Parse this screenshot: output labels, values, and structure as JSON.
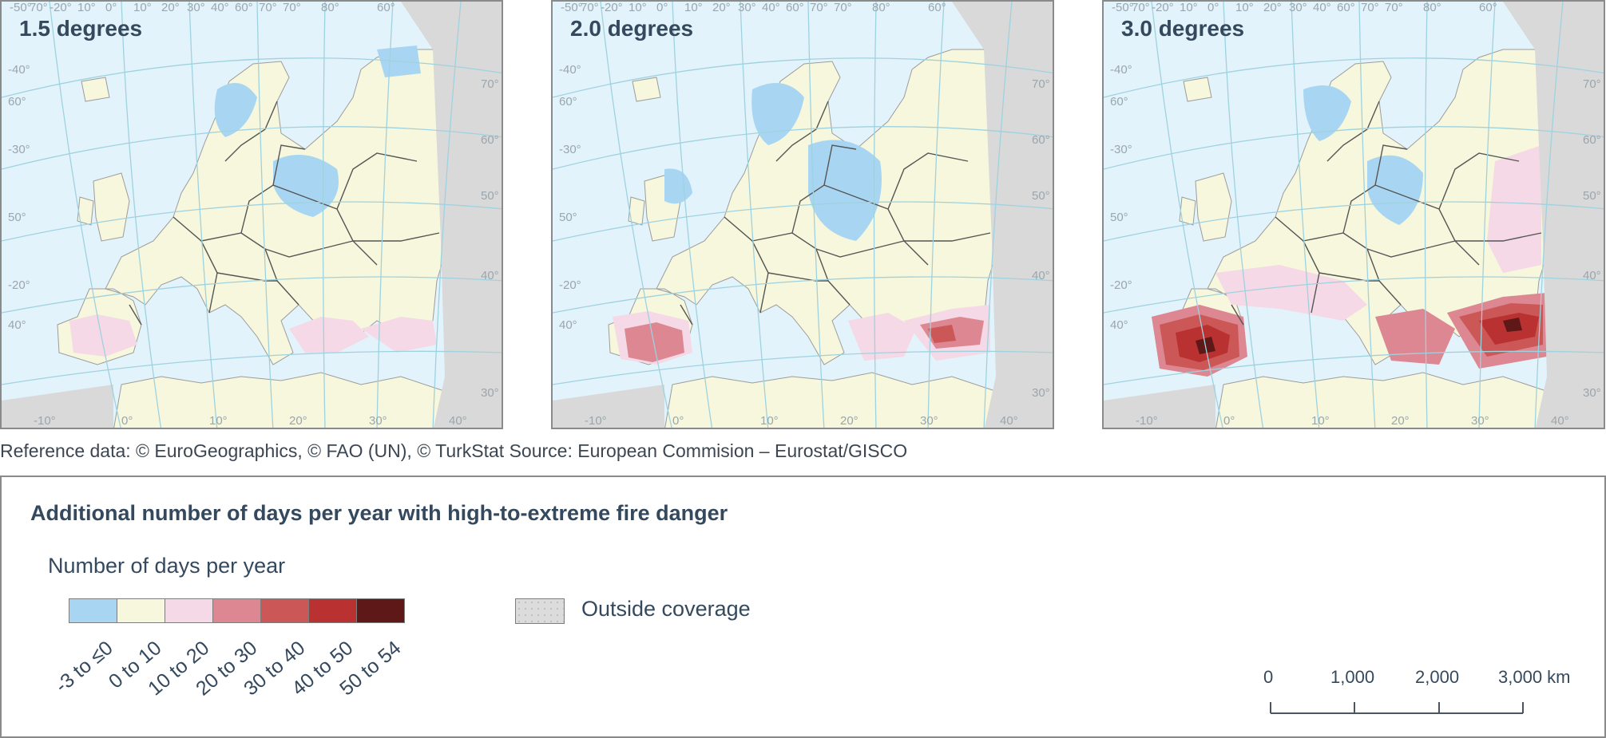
{
  "panels": [
    {
      "title": "1.5 degrees",
      "level": 1
    },
    {
      "title": "2.0 degrees",
      "level": 2
    },
    {
      "title": "3.0 degrees",
      "level": 3
    }
  ],
  "graticule_labels": {
    "top": [
      "-50°",
      "70°",
      "-20°",
      "10°",
      "0°",
      "10°",
      "20°",
      "30°",
      "40°",
      "60°",
      "70°",
      "70°",
      "80°",
      "60°"
    ],
    "left": [
      "-40°",
      "60°",
      "-30°",
      "50°",
      "-20°",
      "40°"
    ],
    "right": [
      "70°",
      "60°",
      "50°",
      "40°",
      "30°"
    ],
    "bottom": [
      "-10°",
      "0°",
      "10°",
      "20°",
      "30°",
      "40°"
    ]
  },
  "source_text": "Reference data: © EuroGeographics, © FAO (UN), © TurkStat Source: European Commision – Eurostat/GISCO",
  "legend": {
    "title": "Additional number of days per year with high-to-extreme fire danger",
    "subtitle": "Number of days per year",
    "classes": [
      {
        "label": "-3 to ≤0",
        "color": "#a8d6f2"
      },
      {
        "label": "0 to 10",
        "color": "#f6f7dc"
      },
      {
        "label": "10 to 20",
        "color": "#f5d9e6"
      },
      {
        "label": "20 to 30",
        "color": "#dc8791"
      },
      {
        "label": "30 to 40",
        "color": "#cc5757"
      },
      {
        "label": "40 to 50",
        "color": "#b93131"
      },
      {
        "label": "50 to 54",
        "color": "#5f1818"
      }
    ],
    "outside_label": "Outside coverage"
  },
  "scale_bar": {
    "labels": [
      "0",
      "1,000",
      "2,000",
      "3,000 km"
    ]
  },
  "colors": {
    "sea": "#e3f3fb",
    "outside": "#d9d9d9",
    "graticule": "#9fd2df",
    "border": "#555555"
  }
}
